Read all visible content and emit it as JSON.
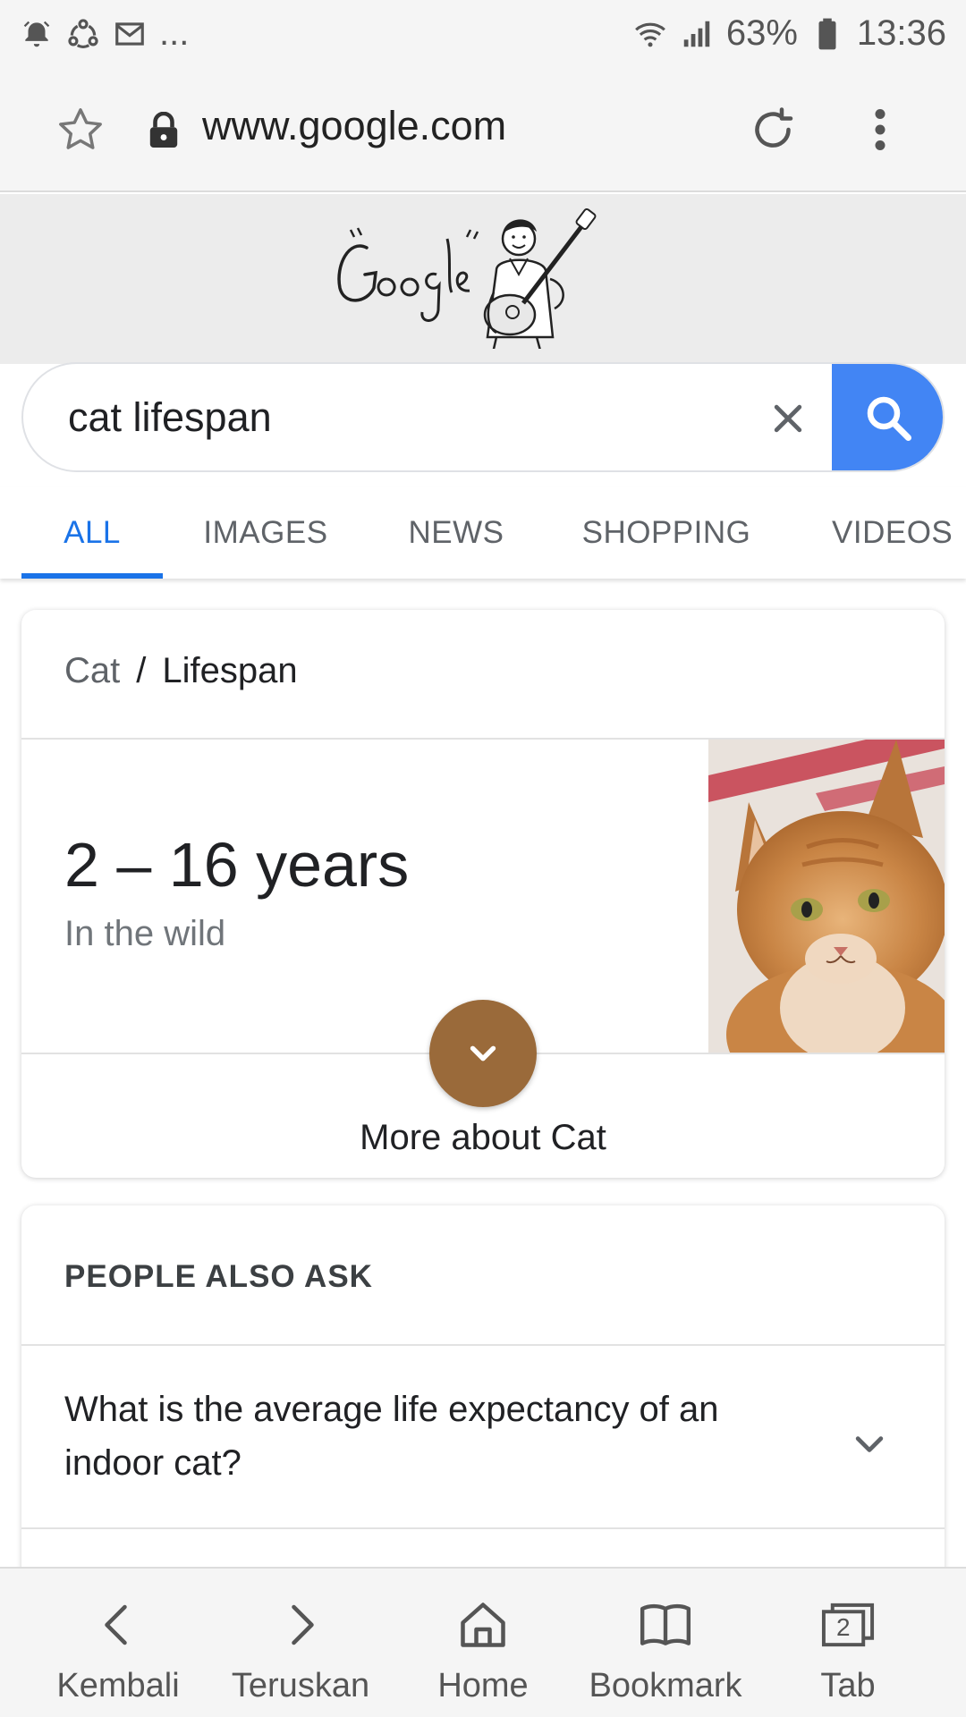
{
  "status_bar": {
    "left_icons": [
      "alarm-icon",
      "sync-icon",
      "gmail-icon"
    ],
    "overflow": "...",
    "battery": "63%",
    "time": "13:36",
    "right_icons": [
      "wifi-icon",
      "signal-icon",
      "battery-icon"
    ]
  },
  "browser": {
    "url": "www.google.com",
    "icons": [
      "star-icon",
      "lock-icon",
      "reload-icon",
      "overflow-menu-icon"
    ]
  },
  "search": {
    "query": "cat lifespan",
    "accent": "#4285f4"
  },
  "tabs": [
    {
      "label": "ALL",
      "active": true
    },
    {
      "label": "IMAGES",
      "active": false
    },
    {
      "label": "NEWS",
      "active": false
    },
    {
      "label": "SHOPPING",
      "active": false
    },
    {
      "label": "VIDEOS",
      "active": false
    }
  ],
  "answer_card": {
    "breadcrumb": {
      "parent": "Cat",
      "separator": "/",
      "current": "Lifespan"
    },
    "value": "2 – 16 years",
    "subtitle": "In the wild",
    "more_label": "More about Cat",
    "button_color": "#9a6a3a"
  },
  "people_also_ask": {
    "title": "PEOPLE ALSO ASK",
    "questions": [
      "What is the average life expectancy of an indoor cat?"
    ]
  },
  "bottom_nav": [
    {
      "label": "Kembali",
      "icon": "back-icon"
    },
    {
      "label": "Teruskan",
      "icon": "forward-icon"
    },
    {
      "label": "Home",
      "icon": "home-icon"
    },
    {
      "label": "Bookmark",
      "icon": "bookmark-icon"
    },
    {
      "label": "Tab",
      "icon": "tabs-icon",
      "count": "2"
    }
  ]
}
